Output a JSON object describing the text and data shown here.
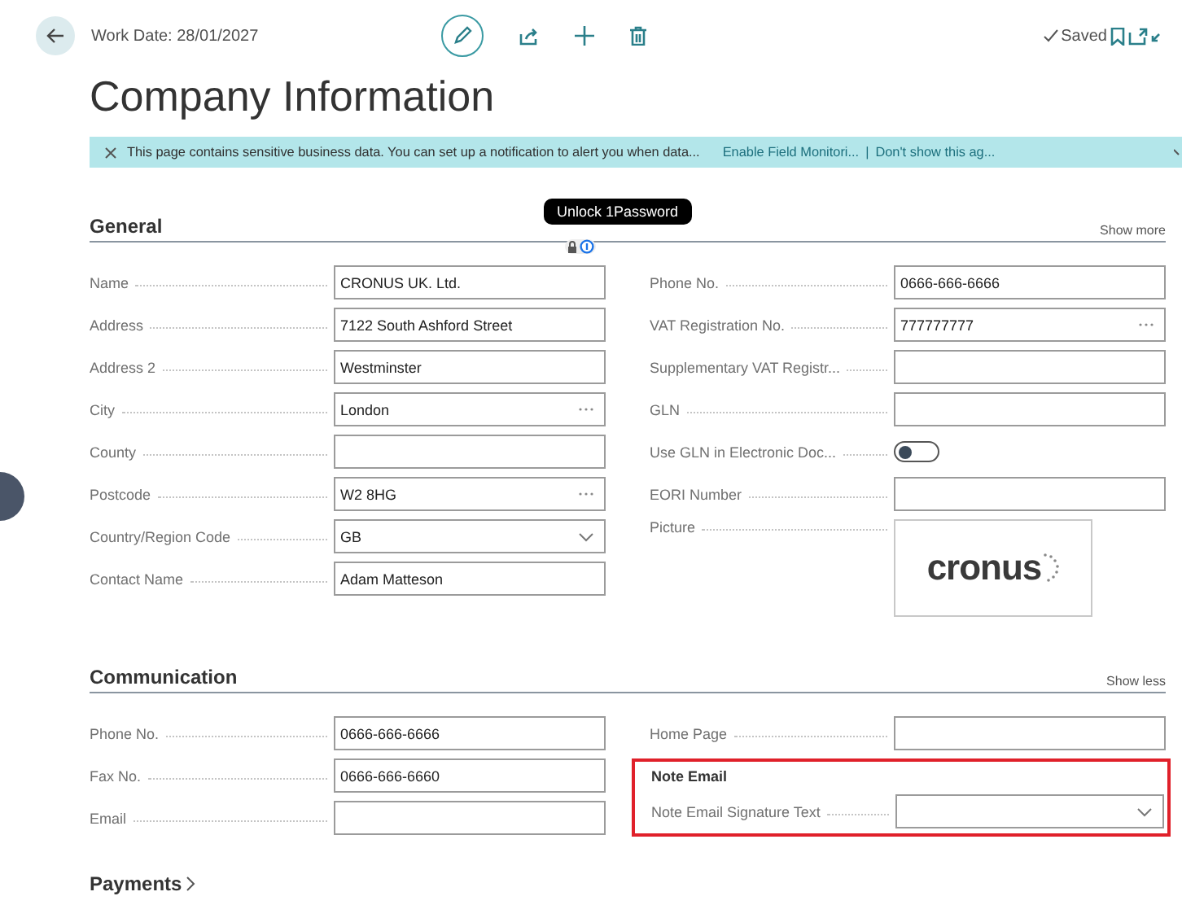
{
  "header": {
    "work_date": "Work Date: 28/01/2027",
    "status": "Saved"
  },
  "title": "Company Information",
  "banner": {
    "message": "This page contains sensitive business data. You can set up a notification to alert you when data...",
    "links": [
      "Enable Field Monitori...",
      "Don't show this ag..."
    ],
    "separator": "|"
  },
  "tooltip": {
    "text": "Unlock 1Password"
  },
  "sections": [
    {
      "title": "General",
      "toggle_link": "Show more",
      "columns": [
        [
          {
            "kind": "text",
            "label": "Name",
            "value": "CRONUS UK. Ltd."
          },
          {
            "kind": "text",
            "label": "Address",
            "value": "7122 South Ashford Street"
          },
          {
            "kind": "text",
            "label": "Address 2",
            "value": "Westminster"
          },
          {
            "kind": "lookup",
            "label": "City",
            "value": "London"
          },
          {
            "kind": "text",
            "label": "County"
          },
          {
            "kind": "lookup",
            "label": "Postcode",
            "value": "W2 8HG"
          },
          {
            "kind": "dropdown",
            "label": "Country/Region Code",
            "value": "GB"
          },
          {
            "kind": "text",
            "label": "Contact Name",
            "value": "Adam Matteson"
          }
        ],
        [
          {
            "kind": "text",
            "label": "Phone No.",
            "value": "0666-666-6666"
          },
          {
            "kind": "lookup",
            "label": "VAT Registration No.",
            "value": "777777777"
          },
          {
            "kind": "text",
            "label": "Supplementary VAT Registr..."
          },
          {
            "kind": "text",
            "label": "GLN"
          },
          {
            "kind": "toggle",
            "label": "Use GLN in Electronic Doc...",
            "on": false
          },
          {
            "kind": "text",
            "label": "EORI Number"
          },
          {
            "kind": "picture",
            "label": "Picture",
            "logo_text": "cronus"
          }
        ]
      ]
    },
    {
      "title": "Communication",
      "toggle_link": "Show less",
      "columns": [
        [
          {
            "kind": "text",
            "label": "Phone No.",
            "value": "0666-666-6666"
          },
          {
            "kind": "text",
            "label": "Fax No.",
            "value": "0666-666-6660"
          },
          {
            "kind": "text",
            "label": "Email"
          }
        ],
        [
          {
            "kind": "text",
            "label": "Home Page"
          },
          {
            "kind": "group",
            "title": "Note Email",
            "highlighted": true,
            "fields": [
              {
                "kind": "dropdown",
                "label": "Note Email Signature Text"
              }
            ]
          }
        ]
      ]
    }
  ],
  "collapsed_section": {
    "title": "Payments"
  }
}
